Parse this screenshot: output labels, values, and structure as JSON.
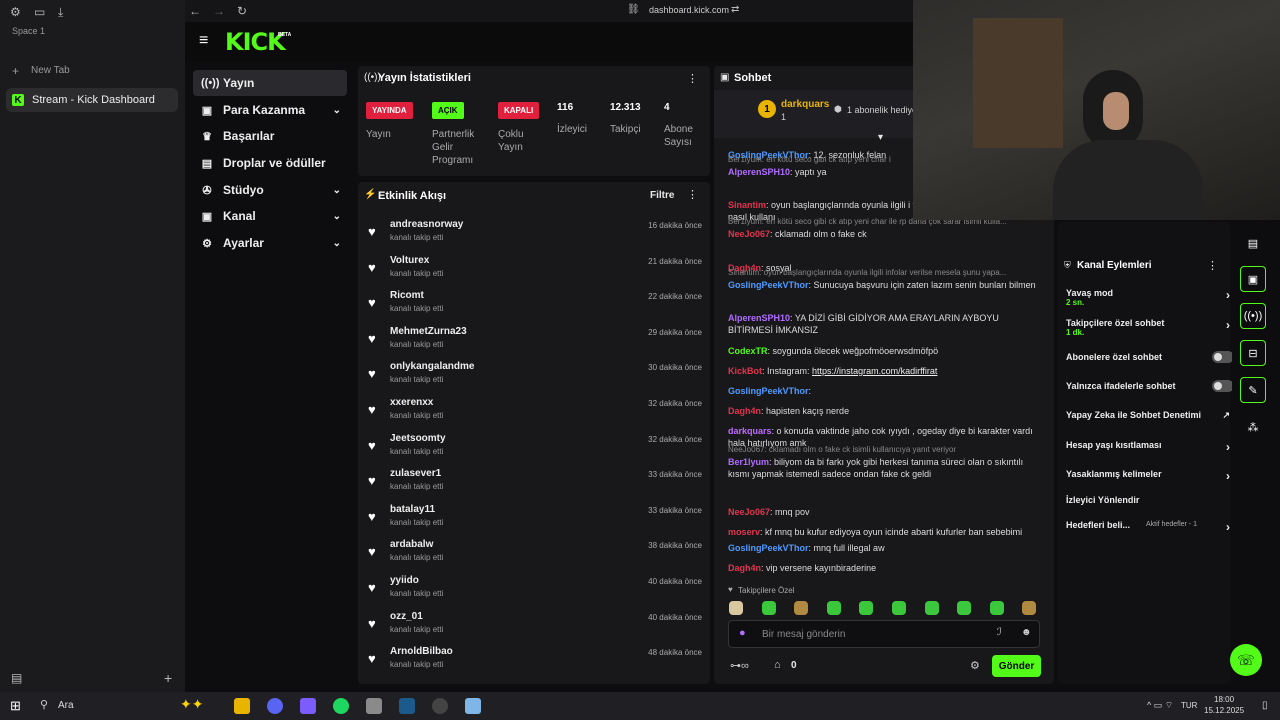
{
  "browser": {
    "space": "Space 1",
    "new_tab": "New Tab",
    "tab_title": "Stream - Kick Dashboard",
    "url": "dashboard.kick.com"
  },
  "kick": {
    "logo": "KICK",
    "beta": "BETA"
  },
  "nav": [
    {
      "label": "Yayın",
      "icon": "broadcast-icon",
      "expandable": false
    },
    {
      "label": "Para Kazanma",
      "icon": "money-icon",
      "expandable": true
    },
    {
      "label": "Başarılar",
      "icon": "trophy-icon",
      "expandable": false
    },
    {
      "label": "Droplar ve ödüller",
      "icon": "gift-icon",
      "expandable": false
    },
    {
      "label": "Stüdyo",
      "icon": "studio-icon",
      "expandable": true
    },
    {
      "label": "Kanal",
      "icon": "channel-icon",
      "expandable": true
    },
    {
      "label": "Ayarlar",
      "icon": "gear-icon",
      "expandable": true
    }
  ],
  "stats": {
    "title": "Yayın İstatistikleri",
    "badges": [
      {
        "text": "YAYINDA",
        "label": "Yayın",
        "color": "#e0203c"
      },
      {
        "text": "AÇIK",
        "label": "Partnerlik Gelir Programı",
        "color": "#53fc18"
      },
      {
        "text": "KAPALI",
        "label": "Çoklu Yayın",
        "color": "#e0203c"
      }
    ],
    "counts": [
      {
        "value": "116",
        "label": "İzleyici"
      },
      {
        "value": "12.313",
        "label": "Takipçi"
      },
      {
        "value": "4",
        "label": "Abone Sayısı"
      }
    ]
  },
  "feed": {
    "title": "Etkinlik Akışı",
    "filter": "Filtre",
    "items": [
      {
        "name": "andreasnorway",
        "action": "kanalı takip etti",
        "time": "16 dakika önce"
      },
      {
        "name": "Volturex",
        "action": "kanalı takip etti",
        "time": "21 dakika önce"
      },
      {
        "name": "Ricomt",
        "action": "kanalı takip etti",
        "time": "22 dakika önce"
      },
      {
        "name": "MehmetZurna23",
        "action": "kanalı takip etti",
        "time": "29 dakika önce"
      },
      {
        "name": "onlykangalandme",
        "action": "kanalı takip etti",
        "time": "30 dakika önce"
      },
      {
        "name": "xxerenxx",
        "action": "kanalı takip etti",
        "time": "32 dakika önce"
      },
      {
        "name": "Jeetsoomty",
        "action": "kanalı takip etti",
        "time": "32 dakika önce"
      },
      {
        "name": "zulasever1",
        "action": "kanalı takip etti",
        "time": "33 dakika önce"
      },
      {
        "name": "batalay11",
        "action": "kanalı takip etti",
        "time": "33 dakika önce"
      },
      {
        "name": "ardabalw",
        "action": "kanalı takip etti",
        "time": "38 dakika önce"
      },
      {
        "name": "yyiido",
        "action": "kanalı takip etti",
        "time": "40 dakika önce"
      },
      {
        "name": "ozz_01",
        "action": "kanalı takip etti",
        "time": "40 dakika önce"
      },
      {
        "name": "ArnoldBilbao",
        "action": "kanalı takip etti",
        "time": "48 dakika önce"
      }
    ]
  },
  "chat": {
    "title": "Sohbet",
    "pinned_user": "darkquars",
    "pinned_rank": "1",
    "gift_text": "1 abonelik hediye",
    "messages": [
      {
        "reply": "",
        "user": "GoslingPeekVThor",
        "ucls": "u-blue",
        "text": ": 12. sezonluk felan"
      },
      {
        "reply": "Ber1lyum: en kötü seco gibi ck atıp yeni char i",
        "user": "AlperenSPH10",
        "ucls": "u-purple",
        "text": ": yaptı ya"
      },
      {
        "reply": "",
        "user": "Sinantim",
        "ucls": "u-red",
        "text": ": oyun başlangıçlarında oyunla ilgili i yaparsan ban olur do/me komutu nasıl kullanı"
      },
      {
        "reply": "Ber1lyum: en kötü seco gibi ck atıp yeni char ile rp daha çok sarar isimli kulla...",
        "user": "NeeJo067",
        "ucls": "u-red",
        "text": ": cklamadı olm o fake ck"
      },
      {
        "reply": "",
        "user": "Dagh4n",
        "ucls": "u-red",
        "text": ": sosyal"
      },
      {
        "reply": "Sinantim: oyun başlangıçlarında oyunla ilgili infolar verilse mesela şunu yapa...",
        "user": "GoslingPeekVThor",
        "ucls": "u-blue",
        "text": ": Sunucuya başvuru için zaten lazım senin bunları bilmen"
      },
      {
        "reply": "",
        "user": "AlperenSPH10",
        "ucls": "u-purple",
        "text": ": YA DİZİ GİBİ GİDİYOR AMA ERAYLARIN AYBOYU BİTİRMESİ İMKANSIZ"
      },
      {
        "reply": "",
        "user": "CodexTR",
        "ucls": "u-green",
        "text": ": soygunda ölecek weğpofmöoerwsdmöfpö"
      },
      {
        "reply": "",
        "user": "KickBot",
        "ucls": "u-red",
        "text": ": Instagram: ",
        "link": "https://instagram.com/kadirffirat"
      },
      {
        "reply": "",
        "user": "GoslingPeekVThor",
        "ucls": "u-blue",
        "text": ":"
      },
      {
        "reply": "",
        "user": "Dagh4n",
        "ucls": "u-red",
        "text": ": hapisten kaçış nerde"
      },
      {
        "reply": "",
        "user": "darkquars",
        "ucls": "u-violet",
        "text": ": o konuda vaktinde jaho cok ıyıydı , ogeday diye bi karakter vardı hala hatırlıyom amk"
      },
      {
        "reply": "NeeJo067: cklamadı olm o fake ck isimli kullanıcıya yanıt veriyor",
        "user": "Ber1lyum",
        "ucls": "u-purple",
        "text": ": biliyom da bi farkı yok gibi herkesi tanıma süreci olan o sıkıntılı kısmı yapmak istemedi sadece ondan fake ck geldi"
      },
      {
        "reply": "",
        "user": "NeeJo067",
        "ucls": "u-red",
        "text": ": mnq pov"
      },
      {
        "reply": "",
        "user": "moserv",
        "ucls": "u-red",
        "text": ": kf mnq bu kufur ediyoya oyun icinde abarti kufurler ban sebebimi"
      },
      {
        "reply": "",
        "user": "GoslingPeekVThor",
        "ucls": "u-blue",
        "text": ": mnq full illegal aw"
      },
      {
        "reply": "",
        "user": "Dagh4n",
        "ucls": "u-red",
        "text": ": vip versene kayınbiraderine"
      }
    ],
    "followers_only": "Takipçilere Özel",
    "input_placeholder": "Bir mesaj gönderin",
    "count": "0",
    "send": "Gönder"
  },
  "actions": {
    "title": "Kanal Eylemleri",
    "items": [
      {
        "label": "Yavaş mod",
        "sub": "2 sn.",
        "kind": "arrow"
      },
      {
        "label": "Takipçilere özel sohbet",
        "sub": "1 dk.",
        "kind": "arrow"
      },
      {
        "label": "Abonelere özel sohbet",
        "sub": "",
        "kind": "toggle"
      },
      {
        "label": "Yalnızca ifadelerle sohbet",
        "sub": "",
        "kind": "toggle"
      },
      {
        "label": "Yapay Zeka ile Sohbet Denetimi",
        "sub": "",
        "kind": "external"
      },
      {
        "label": "Hesap yaşı kısıtlaması",
        "sub": "",
        "kind": "arrow"
      },
      {
        "label": "Yasaklanmış kelimeler",
        "sub": "",
        "kind": "arrow"
      },
      {
        "label": "İzleyici Yönlendir",
        "sub": "",
        "kind": "none"
      },
      {
        "label": "Hedefleri beli...",
        "sub": "",
        "kind": "arrow",
        "extra": "Aktif hedefler - 1"
      }
    ]
  },
  "taskbar": {
    "search": "Ara",
    "lang": "TUR",
    "time": "18:00",
    "date": "15.12.2025"
  },
  "colors": {
    "accent": "#53fc18",
    "live": "#e0203c"
  }
}
